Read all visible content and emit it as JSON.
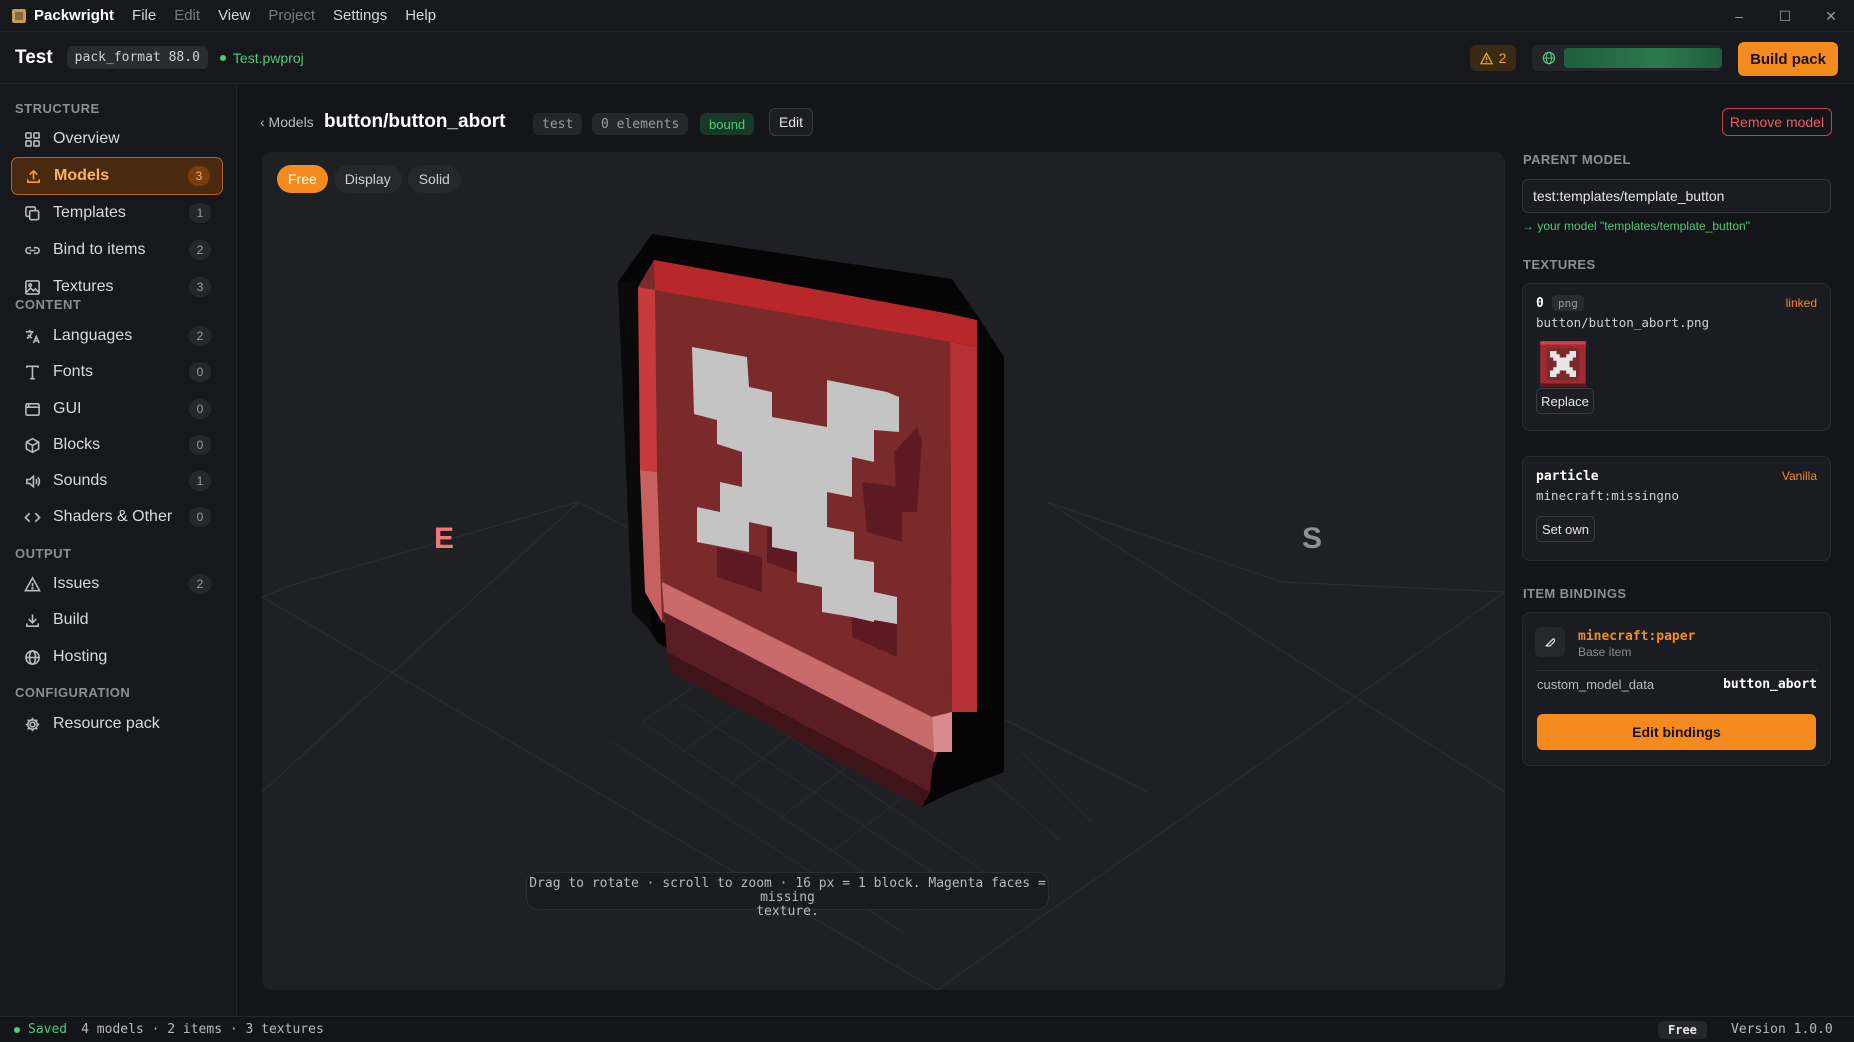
{
  "app": {
    "name": "Packwright"
  },
  "menu": [
    "File",
    "Edit",
    "View",
    "Project",
    "Settings",
    "Help"
  ],
  "window_controls": [
    "–",
    "☐",
    "✕"
  ],
  "project": {
    "name": "Test",
    "pack_format": "pack_format 88.0",
    "file": "Test.pwproj",
    "warnings": "2",
    "build_label": "Build pack"
  },
  "sidebar": {
    "sections": [
      "STRUCTURE",
      "CONTENT",
      "OUTPUT",
      "CONFIGURATION"
    ],
    "items": [
      {
        "label": "Overview",
        "count": "",
        "icon": "grid-icon"
      },
      {
        "label": "Models",
        "count": "3",
        "icon": "upload-icon"
      },
      {
        "label": "Templates",
        "count": "1",
        "icon": "copy-icon"
      },
      {
        "label": "Bind to items",
        "count": "2",
        "icon": "link-icon"
      },
      {
        "label": "Textures",
        "count": "3",
        "icon": "image-icon"
      },
      {
        "label": "Languages",
        "count": "2",
        "icon": "translate-icon"
      },
      {
        "label": "Fonts",
        "count": "0",
        "icon": "type-icon"
      },
      {
        "label": "GUI",
        "count": "0",
        "icon": "window-icon"
      },
      {
        "label": "Blocks",
        "count": "0",
        "icon": "cube-icon"
      },
      {
        "label": "Sounds",
        "count": "1",
        "icon": "speaker-icon"
      },
      {
        "label": "Shaders & Other",
        "count": "0",
        "icon": "code-icon"
      },
      {
        "label": "Issues",
        "count": "2",
        "icon": "warning-icon"
      },
      {
        "label": "Build",
        "count": "",
        "icon": "download-icon"
      },
      {
        "label": "Hosting",
        "count": "",
        "icon": "globe-icon"
      },
      {
        "label": "Resource pack",
        "count": "",
        "icon": "gear-icon"
      }
    ]
  },
  "model": {
    "back": "‹ Models",
    "title": "button/button_abort",
    "namespace": "test",
    "elements": "0 elements",
    "status": "bound",
    "edit_label": "Edit",
    "remove_label": "Remove model"
  },
  "viewport": {
    "modes": [
      "Free",
      "Display",
      "Solid"
    ],
    "active_mode": "Free",
    "compass_e": "E",
    "compass_s": "S",
    "hint_line1": "Drag to rotate · scroll to zoom · 16 px = 1 block. Magenta faces = missing",
    "hint_line2": "texture."
  },
  "right_panel": {
    "parent_heading": "PARENT MODEL",
    "parent_value": "test:templates/template_button",
    "parent_link": "→ your model \"templates/template_button\"",
    "textures_heading": "TEXTURES",
    "texture0": {
      "key": "0",
      "format": "png",
      "state": "linked",
      "path": "button/button_abort.png",
      "button": "Replace"
    },
    "particle": {
      "key": "particle",
      "state": "Vanilla",
      "path": "minecraft:missingno",
      "button": "Set own"
    },
    "bindings_heading": "ITEM BINDINGS",
    "binding": {
      "item": "minecraft:paper",
      "sub": "Base item",
      "prop": "custom_model_data",
      "value": "button_abort",
      "button": "Edit bindings"
    }
  },
  "status": {
    "saved": "Saved",
    "summary": "4 models · 2 items · 3 textures",
    "plan": "Free",
    "version": "Version 1.0.0"
  }
}
